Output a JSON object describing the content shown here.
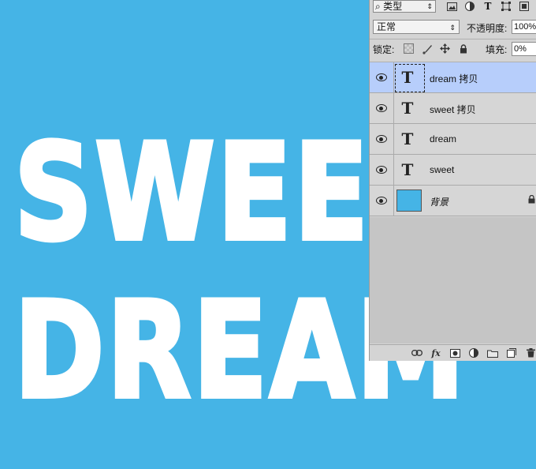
{
  "canvas": {
    "background_color": "#45b4e6",
    "text_color": "#ffffff",
    "line1": "SWEET",
    "line2": "DREAM"
  },
  "layers_panel": {
    "filter": {
      "selected": "类型",
      "search_icon": "search-icon"
    },
    "filter_icons": [
      "image-filter-icon",
      "adjustment-filter-icon",
      "text-filter-icon",
      "shape-filter-icon",
      "smart-object-filter-icon"
    ],
    "blend_mode": "正常",
    "opacity_label": "不透明度:",
    "opacity_value": "100%",
    "lock_label": "锁定:",
    "fill_label": "填充:",
    "fill_value": "0%",
    "layers": [
      {
        "name": "dream 拷贝",
        "type": "text",
        "selected": true,
        "visible": true
      },
      {
        "name": "sweet 拷贝",
        "type": "text",
        "selected": false,
        "visible": true
      },
      {
        "name": "dream",
        "type": "text",
        "selected": false,
        "visible": true
      },
      {
        "name": "sweet",
        "type": "text",
        "selected": false,
        "visible": true
      },
      {
        "name": "背景",
        "type": "background",
        "selected": false,
        "visible": true,
        "locked": true
      }
    ],
    "thumb_text_glyph": "T",
    "selected_color": "#b7cefb"
  }
}
